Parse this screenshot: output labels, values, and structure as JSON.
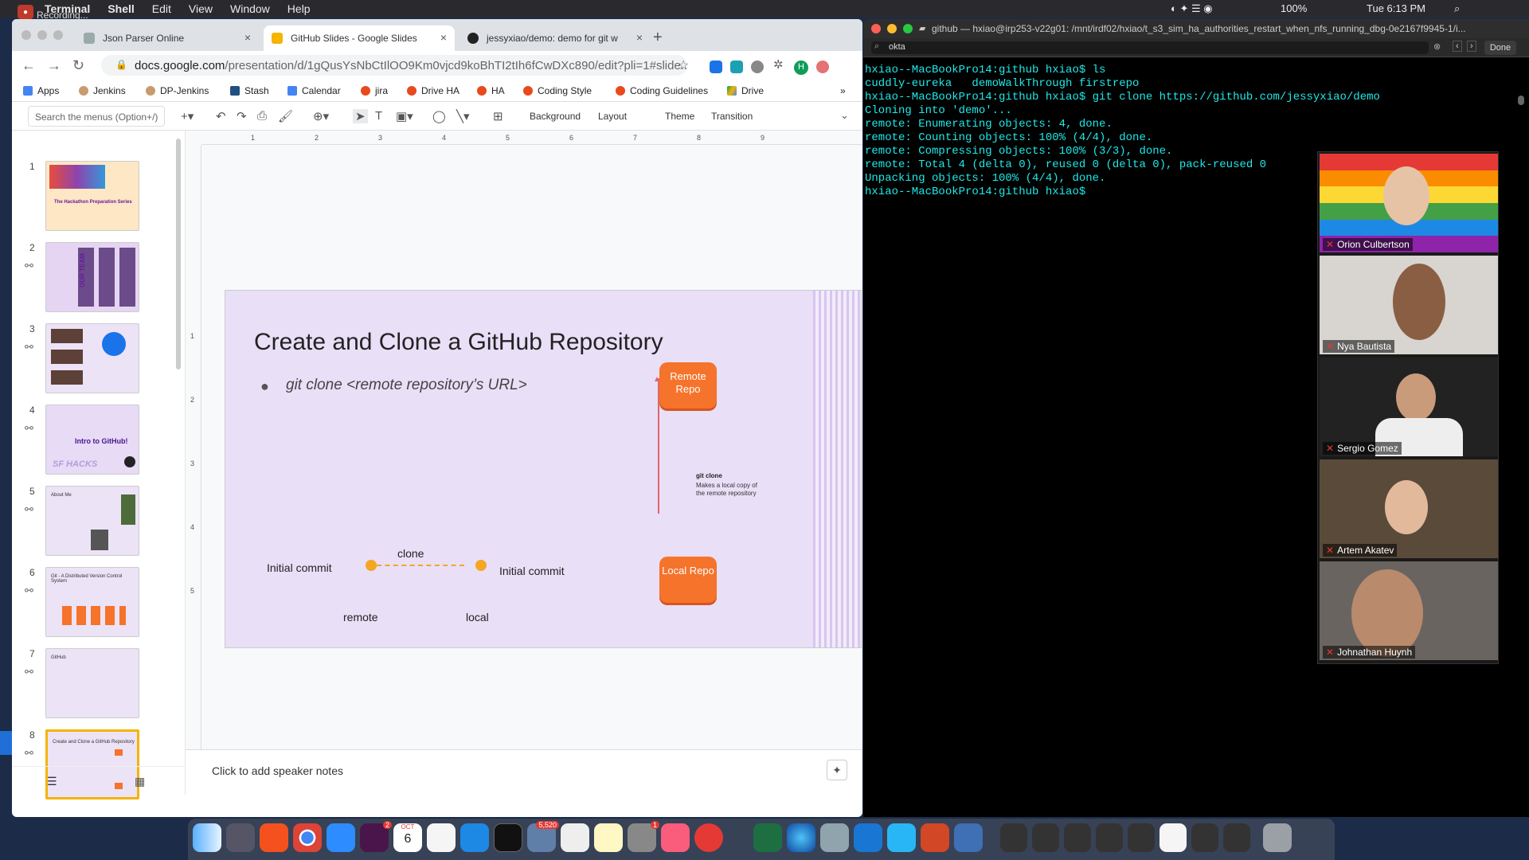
{
  "menubar": {
    "app": "Terminal",
    "items": [
      "Shell",
      "Edit",
      "View",
      "Window",
      "Help"
    ],
    "recording": "Recording...",
    "battery": "100%",
    "clock": "Tue 6:13 PM"
  },
  "browser": {
    "tabs": [
      {
        "label": "Json Parser Online"
      },
      {
        "label": "GitHub Slides - Google Slides"
      },
      {
        "label": "jessyxiao/demo: demo for git w"
      }
    ],
    "new_tab": "+",
    "url_host": "docs.google.com",
    "url_path": "/presentation/d/1gQusYsNbCtIlOO9Km0vjcd9koBhTI2tIh6fCwDXc890/edit?pli=1#slide...",
    "profile_initial": "H",
    "bookmarks": [
      "Apps",
      "Jenkins",
      "DP-Jenkins",
      "Stash",
      "Calendar",
      "jira",
      "Drive HA",
      "HA",
      "Coding Style",
      "Coding Guidelines",
      "Drive"
    ],
    "more": "»"
  },
  "slides_toolbar": {
    "search_placeholder": "Search the menus (Option+/)",
    "background": "Background",
    "layout": "Layout",
    "theme": "Theme",
    "transition": "Transition"
  },
  "filmstrip": {
    "numbers": [
      "1",
      "2",
      "3",
      "4",
      "5",
      "6",
      "7",
      "8"
    ],
    "thumb1_title": "The Hackathon Preparation Series",
    "thumb2_title": "OUR TEAM",
    "thumb4_title": "Intro to GitHub!",
    "thumb4_brand": "SF HACKS",
    "thumb5_title": "About Me",
    "thumb6_title": "Git - A Distributed Version Control System",
    "thumb7_title": "GitHub",
    "thumb8_title": "Create and Clone a GitHub Repository"
  },
  "slide": {
    "title": "Create and Clone a GitHub Repository",
    "bullet": "git clone <remote repository’s URL>",
    "remote_repo": "Remote Repo",
    "local_repo": "Local Repo",
    "git_clone_label": "git clone",
    "git_clone_desc": "Makes a local copy of the remote repository",
    "clone": "clone",
    "initial_commit_left": "Initial commit",
    "initial_commit_right": "Initial commit",
    "remote": "remote",
    "local": "local"
  },
  "ruler_top": [
    "1",
    "2",
    "3",
    "4",
    "5",
    "6",
    "7",
    "8",
    "9"
  ],
  "ruler_left": [
    "1",
    "2",
    "3",
    "4",
    "5"
  ],
  "notes": "Click to add speaker notes",
  "terminal": {
    "title": "github — hxiao@irp253-v22g01: /mnt/irdf02/hxiao/t_s3_sim_ha_authorities_restart_when_nfs_running_dbg-0e2167f9945-1/i...",
    "find_value": "okta",
    "find_done": "Done",
    "lines": "hxiao--MacBookPro14:github hxiao$ ls\ncuddly-eureka   demoWalkThrough firstrepo\nhxiao--MacBookPro14:github hxiao$ git clone https://github.com/jessyxiao/demo\nCloning into 'demo'...\nremote: Enumerating objects: 4, done.\nremote: Counting objects: 100% (4/4), done.\nremote: Compressing objects: 100% (3/3), done.\nremote: Total 4 (delta 0), reused 0 (delta 0), pack-reused 0\nUnpacking objects: 100% (4/4), done.\nhxiao--MacBookPro14:github hxiao$ "
  },
  "participants": [
    "Orion Culbertson",
    "Nya Bautista",
    "Sergio Gomez",
    "Artem Akatev",
    "Johnathan Huynh"
  ],
  "dock": {
    "slack_badge": "2",
    "calendar_month": "OCT",
    "calendar_day": "6",
    "photos_badge": "5,520",
    "prefs_badge": "1"
  },
  "colors": {
    "slide_bg": "#e9dff7",
    "orange": "#f5732b",
    "terminal_text": "#1fe8e8",
    "selected_thumb": "#f4b400"
  }
}
